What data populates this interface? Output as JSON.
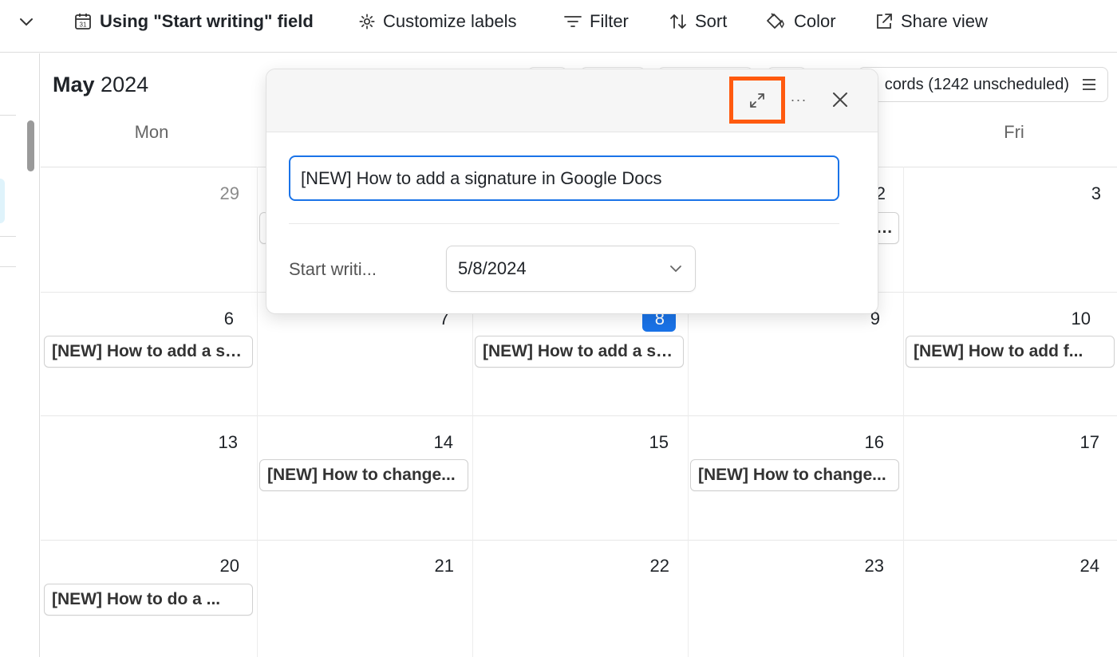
{
  "toolbar": {
    "date_field_label": "Using \"Start writing\" field",
    "customize_label": "Customize labels",
    "filter_label": "Filter",
    "sort_label": "Sort",
    "color_label": "Color",
    "share_label": "Share view"
  },
  "calendar": {
    "month": "May",
    "year": "2024",
    "records_text": "cords (1242 unscheduled)",
    "weekdays": [
      "Mon",
      "Fri"
    ],
    "weeks": [
      {
        "days": [
          "29",
          "",
          "",
          "2",
          "3"
        ]
      },
      {
        "days": [
          "6",
          "7",
          "8",
          "9",
          "10"
        ]
      },
      {
        "days": [
          "13",
          "14",
          "15",
          "16",
          "17"
        ]
      },
      {
        "days": [
          "20",
          "21",
          "22",
          "23",
          "24"
        ]
      }
    ],
    "today_day": "8",
    "events": {
      "w2_mon": "[NEW] How to add a signature in Google Docs",
      "w2_wed": "[NEW] How to add a signature in Google Docs",
      "w2_fri": "[NEW] How to add f...",
      "w3_tue": "[NEW] How to change...",
      "w3_thu": "[NEW] How to change...",
      "w4_mon": "[NEW] How to do a ..."
    }
  },
  "popover": {
    "title_value": "[NEW] How to add a signature in Google Docs",
    "field_label": "Start writi...",
    "date_value": "5/8/2024",
    "more_symbol": "···"
  },
  "colors": {
    "accent": "#1a73e8",
    "highlight_box": "#ff5a0f"
  },
  "icons": [
    "calendar-icon",
    "gear-icon",
    "filter-icon",
    "sort-icon",
    "paint-bucket-icon",
    "share-icon",
    "expand-icon",
    "more-icon",
    "close-icon",
    "chevron-down-icon",
    "list-icon"
  ]
}
